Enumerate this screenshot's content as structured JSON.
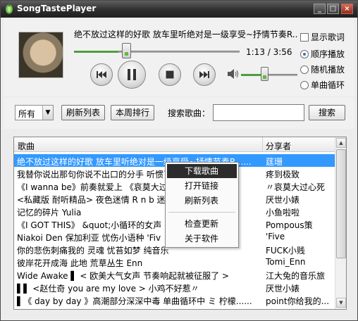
{
  "window": {
    "title": "SongTastePlayer"
  },
  "player": {
    "song_title": "绝不放过这样的好歌 放车里听绝对是一级享受~抒情节奏R...",
    "time": "1:13 / 3:56",
    "progress_fraction": 0.27,
    "volume_fraction": 0.42,
    "options": {
      "show_lyrics": "显示歌词",
      "mode_sequential": "顺序播放",
      "mode_random": "随机播放",
      "mode_single_loop": "单曲循环",
      "selected_mode": "顺序播放"
    }
  },
  "toolbar": {
    "filter_value": "所有",
    "refresh_label": "刷新列表",
    "weekly_rank_label": "本周排行",
    "search_label": "搜索歌曲：",
    "search_value": "",
    "search_button": "搜索"
  },
  "list": {
    "headers": {
      "song": "歌曲",
      "sharer": "分享者"
    },
    "rows": [
      {
        "song": "绝不放过这样的好歌 放车里听绝对是一级享受~抒情节奏R......",
        "sharer": "莛珊"
      },
      {
        "song": "我替你说出那句你说不出口的分手 听惯了",
        "sharer": "疼到极致"
      },
      {
        "song": "《I wanna be》前奏就爱上 《哀莫大过",
        "sharer": "〃哀莫大过心死"
      },
      {
        "song": "<私藏版 耐听精品> 夜色迷情 R n b 迷人",
        "sharer": "厌世小婊"
      },
      {
        "song": "记忆的碎片 Yulia",
        "sharer": "小鱼啦啦"
      },
      {
        "song": "《I GOT THIS》 &quot;小循环的女声",
        "sharer": "Pompous策"
      },
      {
        "song": "Niakoi Den 保加利亚 忧伤小语种  'Fiv",
        "sharer": "'Five"
      },
      {
        "song": "你的悲伤刺痛我的 灵魂 忧苔如梦 纯音乐",
        "sharer": "FUCK小贱"
      },
      {
        "song": "彼岸花开成海 此地 荒草丛生 Enn",
        "sharer": "Tomi_Enn"
      },
      {
        "song": "Wide Awake ▌ < 欧美大气女声 节奏响起就被征服了 >",
        "sharer": "江大兔的音乐旅"
      },
      {
        "song": "▌▌ <赵仕奇 you are my love > 小鸡不好惹〃",
        "sharer": "厌世小婊"
      },
      {
        "song": "▌《 day by day 》高潮部分深深中毒 单曲循环中 ミ 柠檬......",
        "sharer": "point你给我的..."
      }
    ],
    "selected_index": 0,
    "context_menu": {
      "items": [
        "下载歌曲",
        "打开链接",
        "刷新列表",
        "检查更新",
        "关于软件"
      ],
      "highlighted": "下载歌曲"
    }
  }
}
